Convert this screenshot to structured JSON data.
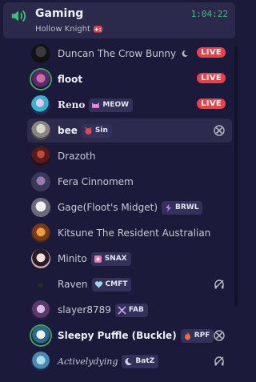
{
  "channel": {
    "name": "Gaming",
    "timer": "1:04:22",
    "activity": "Hollow Knight"
  },
  "live_label": "LIVE",
  "users": [
    {
      "name": "Duncan The Crow Bunny",
      "badge": null,
      "live": true
    },
    {
      "name": "floot",
      "badge": null,
      "live": true
    },
    {
      "name": "Reno",
      "badge": "MEOW",
      "live": true
    },
    {
      "name": "bee",
      "badge": "Sin",
      "status": "xbox-icon"
    },
    {
      "name": "Drazoth",
      "badge": null
    },
    {
      "name": "Fera Cinnomem",
      "badge": null
    },
    {
      "name": "Gage(Floot's Midget)",
      "badge": "BRWL"
    },
    {
      "name": "Kitsune The Resident Australian",
      "badge": null
    },
    {
      "name": "Minito",
      "badge": "SNAX"
    },
    {
      "name": "Raven",
      "badge": "CMFT",
      "status": "deafened-icon"
    },
    {
      "name": "slayer8789",
      "badge": "FAB"
    },
    {
      "name": "Sleepy Puffle (Buckle)",
      "badge": "RPF",
      "status": "xbox-icon"
    },
    {
      "name": "Activelydying",
      "badge": "BatZ",
      "status": "deafened-icon"
    }
  ],
  "colors": {
    "background": "#1c1a3a",
    "live": "#ed4245",
    "speaking_ring": "#3ba55c",
    "timer": "#3fc07a"
  }
}
